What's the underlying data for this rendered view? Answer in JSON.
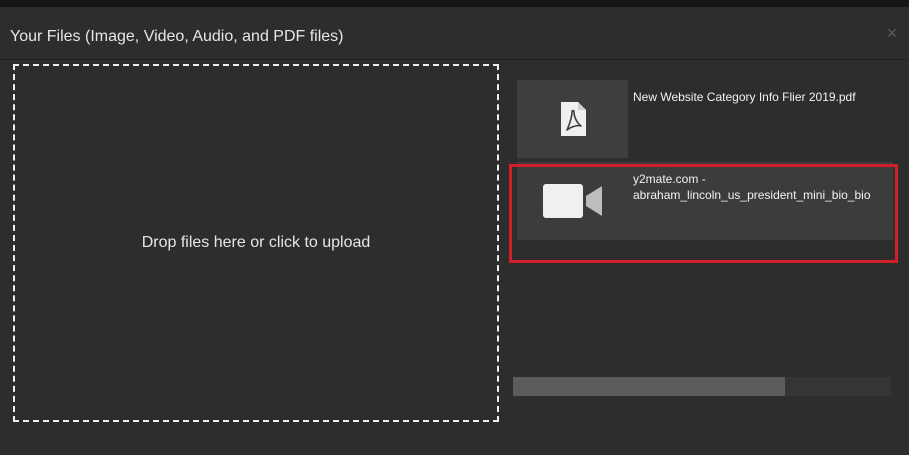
{
  "dialog": {
    "title": "Your Files (Image, Video, Audio, and PDF files)",
    "close_label": "×"
  },
  "dropzone": {
    "label": "Drop files here or click to upload"
  },
  "files": [
    {
      "name_line1": "New Website Category Info Flier 2019.pdf",
      "name_line2": "",
      "icon": "pdf-file-icon"
    },
    {
      "name_line1": "y2mate.com -",
      "name_line2": "abraham_lincoln_us_president_mini_bio_bio",
      "icon": "video-camera-icon",
      "selected": true
    }
  ],
  "scroll": {
    "progress": 0.72
  },
  "colors": {
    "selected_outline": "#d1202a",
    "background": "#2d2d2d"
  }
}
